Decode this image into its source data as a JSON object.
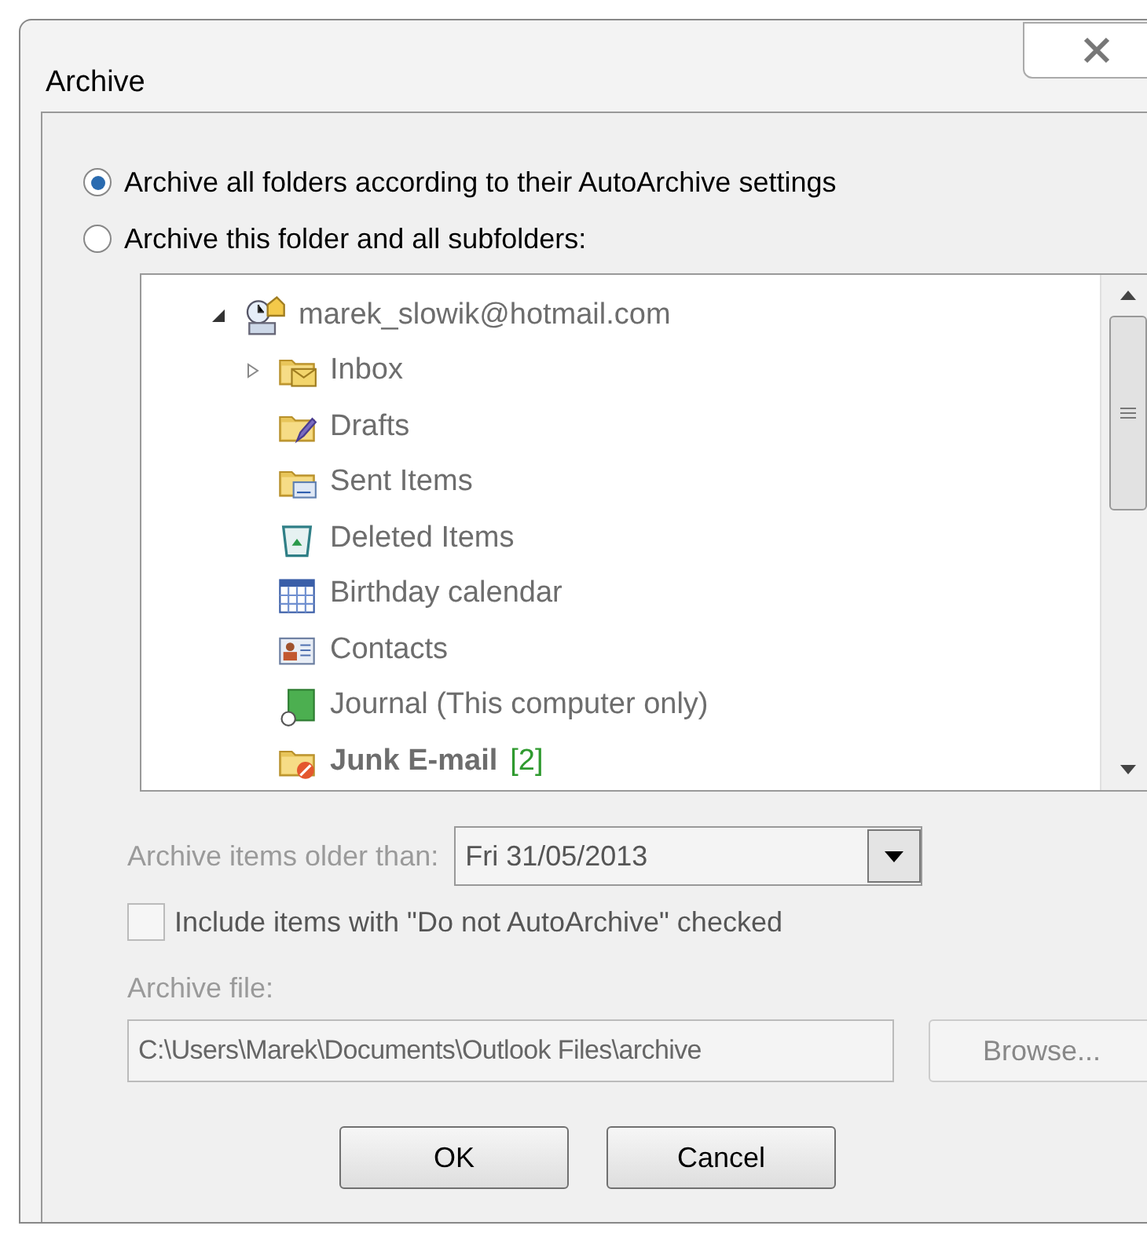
{
  "window": {
    "title": "Archive"
  },
  "options": [
    {
      "label": "Archive all folders according to their AutoArchive settings",
      "selected": true
    },
    {
      "label": "Archive this folder and all subfolders:",
      "selected": false
    }
  ],
  "folder_tree": {
    "disabled": true,
    "root": {
      "label": "marek_slowik@hotmail.com",
      "expanded": true,
      "children": [
        {
          "label": "Inbox",
          "expandable": true,
          "expanded": false,
          "bold": false
        },
        {
          "label": "Drafts",
          "bold": false
        },
        {
          "label": "Sent Items",
          "bold": false
        },
        {
          "label": "Deleted Items",
          "bold": false
        },
        {
          "label": "Birthday calendar",
          "bold": false
        },
        {
          "label": "Contacts",
          "bold": false
        },
        {
          "label": "Journal (This computer only)",
          "bold": false
        },
        {
          "label": "Junk E-mail",
          "bold": true,
          "count": "[2]"
        }
      ]
    }
  },
  "older_than": {
    "label": "Archive items older than:",
    "value": "Fri 31/05/2013",
    "disabled": true
  },
  "include_checkbox": {
    "label": "Include items with \"Do not AutoArchive\" checked",
    "checked": false,
    "disabled": true
  },
  "archive_file": {
    "label": "Archive file:",
    "value": "C:\\Users\\Marek\\Documents\\Outlook Files\\archive",
    "disabled": true
  },
  "browse_button": {
    "label": "Browse...",
    "disabled": true
  },
  "buttons": [
    "OK",
    "Cancel"
  ]
}
